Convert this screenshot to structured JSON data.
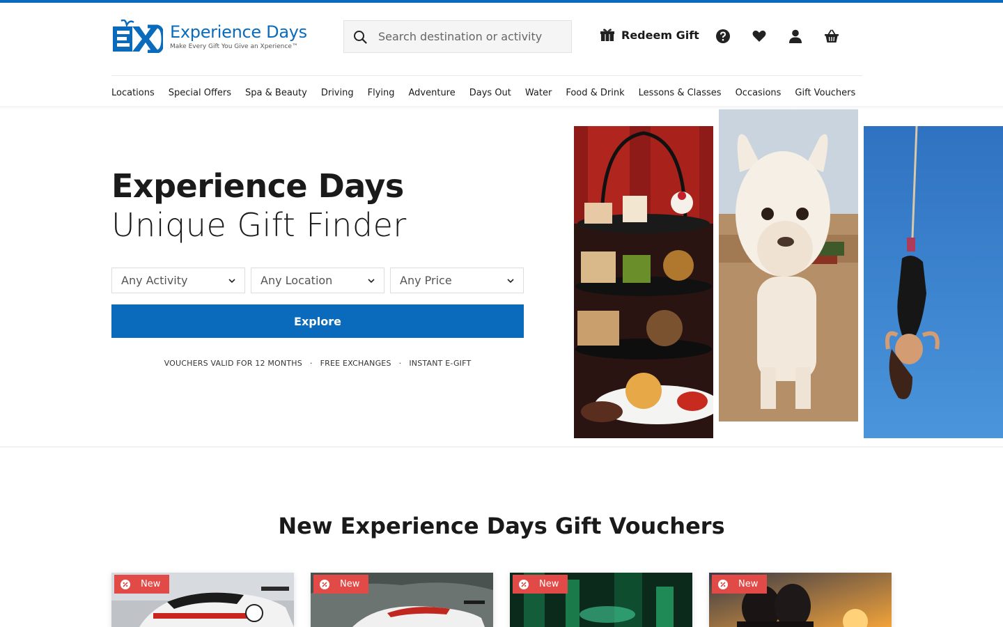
{
  "brand": {
    "name": "Experience Days",
    "tagline": "Make Every Gift You Give an Xperience™",
    "primary_color": "#0a6bbd"
  },
  "header": {
    "search": {
      "placeholder": "Search destination or activity",
      "value": ""
    },
    "redeem_label": "Redeem Gift",
    "icons": [
      "help-icon",
      "wishlist-heart-icon",
      "account-user-icon",
      "basket-icon"
    ]
  },
  "nav": {
    "items": [
      {
        "label": "Locations"
      },
      {
        "label": "Special Offers"
      },
      {
        "label": "Spa & Beauty"
      },
      {
        "label": "Driving"
      },
      {
        "label": "Flying"
      },
      {
        "label": "Adventure"
      },
      {
        "label": "Days Out"
      },
      {
        "label": "Water"
      },
      {
        "label": "Food & Drink"
      },
      {
        "label": "Lessons & Classes"
      },
      {
        "label": "Occasions"
      },
      {
        "label": "Gift Vouchers"
      }
    ]
  },
  "hero": {
    "title": "Experience Days",
    "subtitle": "Unique Gift Finder",
    "filters": [
      {
        "label": "Any Activity"
      },
      {
        "label": "Any Location"
      },
      {
        "label": "Any Price"
      }
    ],
    "explore_label": "Explore",
    "usps": [
      "VOUCHERS VALID FOR 12 MONTHS",
      "FREE EXCHANGES",
      "INSTANT E-GIFT"
    ],
    "images": [
      "afternoon-tea-image",
      "alpaca-image",
      "bungee-jump-image"
    ]
  },
  "new_section": {
    "title": "New Experience Days Gift Vouchers",
    "cards": [
      {
        "badge": "New",
        "image": "porsche-race-car-image"
      },
      {
        "badge": "New",
        "image": "race-car-track-image"
      },
      {
        "badge": "New",
        "image": "green-lights-venue-image"
      },
      {
        "badge": "New",
        "image": "sunset-couple-image"
      }
    ],
    "badge_color": "#e24a47"
  }
}
